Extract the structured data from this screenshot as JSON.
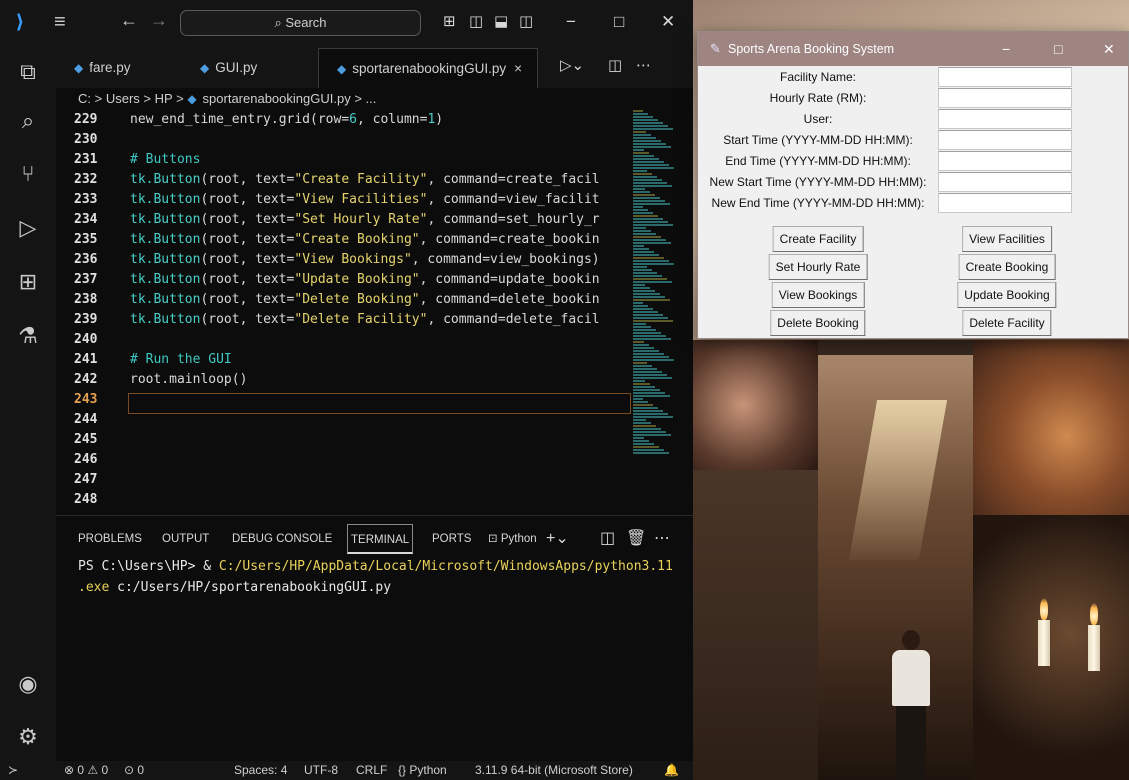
{
  "vscode": {
    "search_label": "Search",
    "tabs": [
      {
        "label": "fare.py"
      },
      {
        "label": "GUI.py"
      },
      {
        "label": "sportarenabookingGUI.py",
        "close": "×"
      }
    ],
    "breadcrumb": [
      "C:",
      ">",
      "Users",
      ">",
      "HP",
      ">",
      "sportarenabookingGUI.py",
      ">",
      "..."
    ],
    "code_lines": [
      {
        "n": "229",
        "tokens": [
          [
            "pl",
            "new_end_time_entry.grid(row"
          ],
          [
            "pl",
            "="
          ],
          [
            "num",
            "6"
          ],
          [
            "pl",
            ", column="
          ],
          [
            "num",
            "1"
          ],
          [
            "pl",
            ")"
          ]
        ]
      },
      {
        "n": "230",
        "tokens": []
      },
      {
        "n": "231",
        "tokens": [
          [
            "cm",
            "# Buttons"
          ]
        ]
      },
      {
        "n": "232",
        "tokens": [
          [
            "fn",
            "tk.Button"
          ],
          [
            "pl",
            "(root, text="
          ],
          [
            "str",
            "\"Create Facility\""
          ],
          [
            "pl",
            ", command=create_facil"
          ]
        ]
      },
      {
        "n": "233",
        "tokens": [
          [
            "fn",
            "tk.Button"
          ],
          [
            "pl",
            "(root, text="
          ],
          [
            "str",
            "\"View Facilities\""
          ],
          [
            "pl",
            ", command=view_facilit"
          ]
        ]
      },
      {
        "n": "234",
        "tokens": [
          [
            "fn",
            "tk.Button"
          ],
          [
            "pl",
            "(root, text="
          ],
          [
            "str",
            "\"Set Hourly Rate\""
          ],
          [
            "pl",
            ", command=set_hourly_r"
          ]
        ]
      },
      {
        "n": "235",
        "tokens": [
          [
            "fn",
            "tk.Button"
          ],
          [
            "pl",
            "(root, text="
          ],
          [
            "str",
            "\"Create Booking\""
          ],
          [
            "pl",
            ", command=create_bookin"
          ]
        ]
      },
      {
        "n": "236",
        "tokens": [
          [
            "fn",
            "tk.Button"
          ],
          [
            "pl",
            "(root, text="
          ],
          [
            "str",
            "\"View Bookings\""
          ],
          [
            "pl",
            ", command=view_bookings)"
          ]
        ]
      },
      {
        "n": "237",
        "tokens": [
          [
            "fn",
            "tk.Button"
          ],
          [
            "pl",
            "(root, text="
          ],
          [
            "str",
            "\"Update Booking\""
          ],
          [
            "pl",
            ", command=update_bookin"
          ]
        ]
      },
      {
        "n": "238",
        "tokens": [
          [
            "fn",
            "tk.Button"
          ],
          [
            "pl",
            "(root, text="
          ],
          [
            "str",
            "\"Delete Booking\""
          ],
          [
            "pl",
            ", command=delete_bookin"
          ]
        ]
      },
      {
        "n": "239",
        "tokens": [
          [
            "fn",
            "tk.Button"
          ],
          [
            "pl",
            "(root, text="
          ],
          [
            "str",
            "\"Delete Facility\""
          ],
          [
            "pl",
            ", command=delete_facil"
          ]
        ]
      },
      {
        "n": "240",
        "tokens": []
      },
      {
        "n": "241",
        "tokens": [
          [
            "cm",
            "# Run the GUI"
          ]
        ]
      },
      {
        "n": "242",
        "tokens": [
          [
            "pl",
            "root.mainloop()"
          ]
        ]
      },
      {
        "n": "243",
        "tokens": [],
        "current": true
      },
      {
        "n": "244",
        "tokens": []
      },
      {
        "n": "245",
        "tokens": []
      },
      {
        "n": "246",
        "tokens": []
      },
      {
        "n": "247",
        "tokens": []
      },
      {
        "n": "248",
        "tokens": []
      }
    ],
    "panel_tabs": [
      "PROBLEMS",
      "OUTPUT",
      "DEBUG CONSOLE",
      "TERMINAL",
      "PORTS"
    ],
    "active_panel_tab": "TERMINAL",
    "terminal_profile": "Python",
    "terminal": {
      "prompt": "PS C:\\Users\\HP> & ",
      "path1": "C:/Users/HP/AppData/Local/Microsoft/WindowsApps/python3.11",
      "path2": ".exe",
      "arg": " c:/Users/HP/sportarenabookingGUI.py"
    },
    "status": {
      "errors": "⊗ 0 ⚠ 0",
      "ports": "0",
      "spaces": "Spaces: 4",
      "encoding": "UTF-8",
      "eol": "CRLF",
      "language": "{} Python",
      "interpreter": "3.11.9 64-bit (Microsoft Store)"
    }
  },
  "tk_app": {
    "title": "Sports Arena Booking System",
    "fields": [
      "Facility Name:",
      "Hourly Rate (RM):",
      "User:",
      "Start Time (YYYY-MM-DD HH:MM):",
      "End Time (YYYY-MM-DD HH:MM):",
      "New Start Time (YYYY-MM-DD HH:MM):",
      "New End Time (YYYY-MM-DD HH:MM):"
    ],
    "buttons": [
      "Create Facility",
      "View Facilities",
      "Set Hourly Rate",
      "Create Booking",
      "View Bookings",
      "Update Booking",
      "Delete Booking",
      "Delete Facility"
    ]
  }
}
